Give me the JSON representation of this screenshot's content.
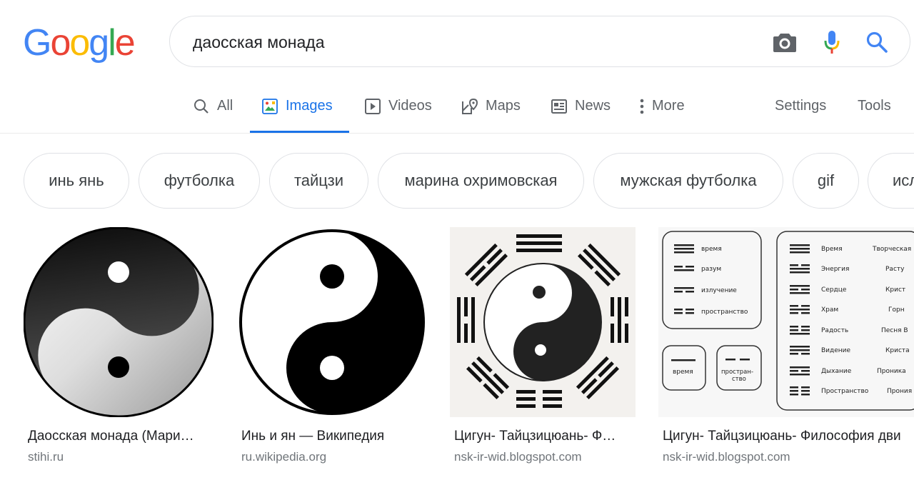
{
  "logo": {
    "letters": [
      "G",
      "o",
      "o",
      "g",
      "l",
      "e"
    ],
    "colors": [
      "#4285f4",
      "#ea4335",
      "#fbbc05",
      "#4285f4",
      "#34a853",
      "#ea4335"
    ]
  },
  "search": {
    "value": "даосская монада",
    "icons": [
      "camera-icon",
      "microphone-icon",
      "search-icon"
    ]
  },
  "tabs": [
    {
      "label": "All",
      "icon": "search-icon"
    },
    {
      "label": "Images",
      "icon": "image-icon",
      "active": true
    },
    {
      "label": "Videos",
      "icon": "play-icon"
    },
    {
      "label": "Maps",
      "icon": "map-icon"
    },
    {
      "label": "News",
      "icon": "news-icon"
    },
    {
      "label": "More",
      "icon": "more-vert-icon"
    },
    {
      "label": "Settings"
    },
    {
      "label": "Tools"
    }
  ],
  "chips": [
    "инь янь",
    "футболка",
    "тайцзи",
    "марина охримовская",
    "мужская футболка",
    "gif",
    "исл"
  ],
  "results": [
    {
      "title": "Даосская монада (Мари…",
      "source": "stihi.ru"
    },
    {
      "title": "Инь и ян — Википедия",
      "source": "ru.wikipedia.org"
    },
    {
      "title": "Цигун- Тайцзицюань- Ф…",
      "source": "nsk-ir-wid.blogspot.com"
    },
    {
      "title": "Цигун- Тайцзицюань- Философия дви",
      "source": "nsk-ir-wid.blogspot.com"
    }
  ],
  "diagram": {
    "left_top": [
      "время",
      "разум",
      "излучение",
      "пространство"
    ],
    "left_bottom": [
      "время",
      "простран-\nство"
    ],
    "right_col1": [
      "Время",
      "Энергия",
      "Сердце",
      "Храм",
      "Радость",
      "Видение",
      "Дыхание",
      "Пространство"
    ],
    "right_col2": [
      "Творческая",
      "Расту",
      "Крист",
      "Горн",
      "Песня В",
      "Криста",
      "Проника",
      "Прония"
    ]
  },
  "colors": {
    "accent": "#1a73e8",
    "muted": "#5f6368",
    "border": "#dfe1e5"
  }
}
